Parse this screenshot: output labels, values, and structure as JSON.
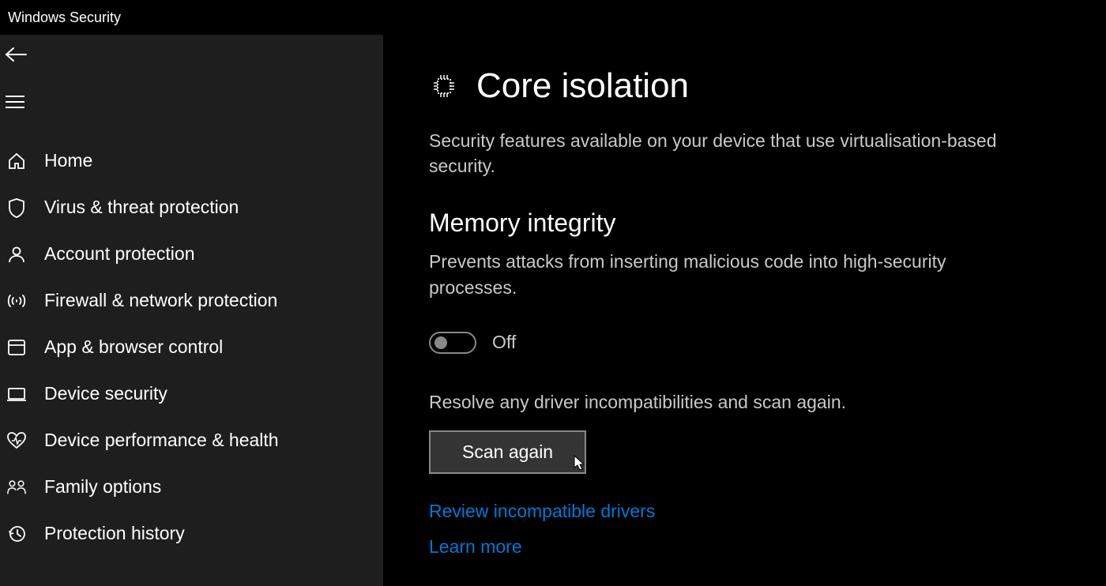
{
  "app": {
    "title": "Windows Security"
  },
  "sidebar": {
    "items": [
      {
        "label": "Home",
        "icon": "home"
      },
      {
        "label": "Virus & threat protection",
        "icon": "shield"
      },
      {
        "label": "Account protection",
        "icon": "account"
      },
      {
        "label": "Firewall & network protection",
        "icon": "firewall"
      },
      {
        "label": "App & browser control",
        "icon": "browser"
      },
      {
        "label": "Device security",
        "icon": "device"
      },
      {
        "label": "Device performance & health",
        "icon": "health"
      },
      {
        "label": "Family options",
        "icon": "family"
      },
      {
        "label": "Protection history",
        "icon": "history"
      }
    ]
  },
  "main": {
    "title": "Core isolation",
    "description": "Security features available on your device that use virtualisation-based security.",
    "section": {
      "title": "Memory integrity",
      "description": "Prevents attacks from inserting malicious code into high-security processes."
    },
    "toggle": {
      "state": "Off"
    },
    "resolve_text": "Resolve any driver incompatibilities and scan again.",
    "scan_button": "Scan again",
    "review_link": "Review incompatible drivers",
    "learn_more": "Learn more"
  }
}
